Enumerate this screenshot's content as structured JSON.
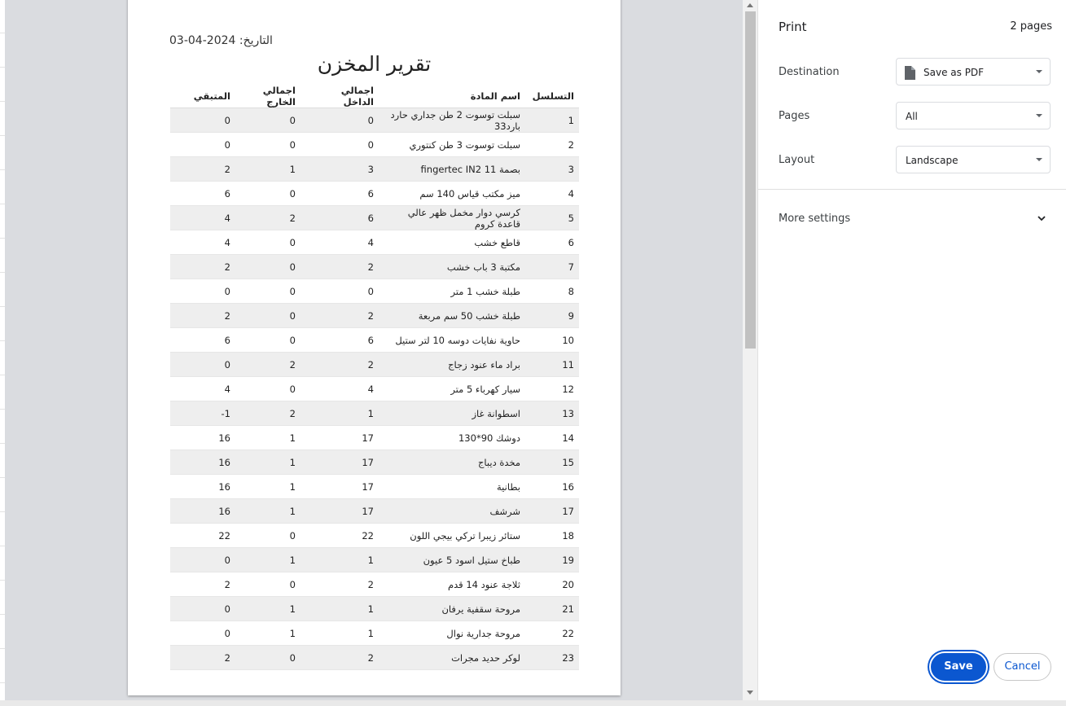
{
  "preview": {
    "date_text": "التاريخ: 2024-04-03",
    "report_title": "تقرير المخزن",
    "columns": [
      "التسلسل",
      "اسم المادة",
      "اجمالي الداخل",
      "اجمالي الخارج",
      "المتبقي"
    ],
    "rows": [
      [
        "1",
        "سبلت توسوت 2 طن جداري حارد بارد33",
        "0",
        "0",
        "0"
      ],
      [
        "2",
        "سبلت توسوت 3 طن كنتوري",
        "0",
        "0",
        "0"
      ],
      [
        "3",
        "بصمة fingertec IN2 11",
        "3",
        "1",
        "2"
      ],
      [
        "4",
        "ميز مكتب قياس 140 سم",
        "6",
        "0",
        "6"
      ],
      [
        "5",
        "كرسي دوار مخمل ظهر عالي قاعدة كروم",
        "6",
        "2",
        "4"
      ],
      [
        "6",
        "قاطع خشب",
        "4",
        "0",
        "4"
      ],
      [
        "7",
        "مكتبة 3 باب خشب",
        "2",
        "0",
        "2"
      ],
      [
        "8",
        "طبلة خشب 1 متر",
        "0",
        "0",
        "0"
      ],
      [
        "9",
        "طبلة خشب 50 سم مربعة",
        "2",
        "0",
        "2"
      ],
      [
        "10",
        "حاوية نفايات دوسه 10 لتر ستيل",
        "6",
        "0",
        "6"
      ],
      [
        "11",
        "براد ماء عنود زجاج",
        "2",
        "2",
        "0"
      ],
      [
        "12",
        "سيار كهرباء 5 متر",
        "4",
        "0",
        "4"
      ],
      [
        "13",
        "اسطوانة غاز",
        "1",
        "2",
        "-1"
      ],
      [
        "14",
        "دوشك 90*130",
        "17",
        "1",
        "16"
      ],
      [
        "15",
        "مخدة ديباج",
        "17",
        "1",
        "16"
      ],
      [
        "16",
        "بطانية",
        "17",
        "1",
        "16"
      ],
      [
        "17",
        "شرشف",
        "17",
        "1",
        "16"
      ],
      [
        "18",
        "ستائر زيبرا تركي بيجي اللون",
        "22",
        "0",
        "22"
      ],
      [
        "19",
        "طباخ ستيل اسود 5 عيون",
        "1",
        "1",
        "0"
      ],
      [
        "20",
        "ثلاجة عنود 14 قدم",
        "2",
        "0",
        "2"
      ],
      [
        "21",
        "مروحة سقفية يرفان",
        "1",
        "1",
        "0"
      ],
      [
        "22",
        "مروحة جدارية نوال",
        "1",
        "1",
        "0"
      ],
      [
        "23",
        "لوكر حديد مجرات",
        "2",
        "0",
        "2"
      ]
    ]
  },
  "panel": {
    "title": "Print",
    "page_count": "2 pages",
    "destination": {
      "label": "Destination",
      "value": "Save as PDF",
      "icon": "document-icon"
    },
    "pages": {
      "label": "Pages",
      "value": "All"
    },
    "layout": {
      "label": "Layout",
      "value": "Landscape"
    },
    "more_settings": "More settings",
    "save_label": "Save",
    "cancel_label": "Cancel",
    "accent_color": "#0b57d0"
  }
}
